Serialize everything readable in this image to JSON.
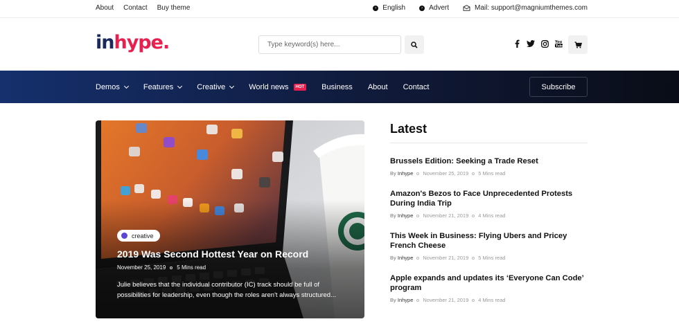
{
  "topbar": {
    "links": [
      "About",
      "Contact",
      "Buy theme"
    ],
    "language": "English",
    "advert": "Advert",
    "mail": "Mail: support@magniumthemes.com"
  },
  "header": {
    "logo_part1": "in",
    "logo_part2": "hype.",
    "search_placeholder": "Type keyword(s) here...",
    "social_icons": [
      "facebook-icon",
      "twitter-icon",
      "instagram-icon",
      "youtube-icon"
    ]
  },
  "nav": {
    "items": [
      {
        "label": "Demos",
        "dropdown": true
      },
      {
        "label": "Features",
        "dropdown": true
      },
      {
        "label": "Creative",
        "dropdown": true
      },
      {
        "label": "World news",
        "dropdown": false,
        "badge": "HOT"
      },
      {
        "label": "Business",
        "dropdown": false
      },
      {
        "label": "About",
        "dropdown": false
      },
      {
        "label": "Contact",
        "dropdown": false
      }
    ],
    "subscribe": "Subscribe"
  },
  "feature": {
    "tag": "creative",
    "title": "2019 Was Second Hottest Year on Record",
    "date": "November 25, 2019",
    "read": "5 Mins read",
    "excerpt": "Julie believes that the individual contributor (IC) track should be full of possibilities for leadership, even though the roles aren't always structured..."
  },
  "latest": {
    "heading": "Latest",
    "posts": [
      {
        "title": "Brussels Edition: Seeking a Trade Reset",
        "by": "By",
        "author": "Inhype",
        "date": "November 25, 2019",
        "read": "5 Mins read"
      },
      {
        "title": "Amazon's Bezos to Face Unprecedented Protests During India Trip",
        "by": "By",
        "author": "Inhype",
        "date": "November 21, 2019",
        "read": "4 Mins read"
      },
      {
        "title": "This Week in Business: Flying Ubers and Pricey French Cheese",
        "by": "By",
        "author": "Inhype",
        "date": "November 21, 2019",
        "read": "5 Mins read"
      },
      {
        "title": "Apple expands and updates its ‘Everyone Can Code’ program",
        "by": "By",
        "author": "Inhype",
        "date": "November 21, 2019",
        "read": "4 Mins read"
      }
    ]
  },
  "colors": {
    "brand_navy": "#1a2a5e",
    "brand_red": "#e8204f",
    "tag_dot": "#5b46d6"
  }
}
